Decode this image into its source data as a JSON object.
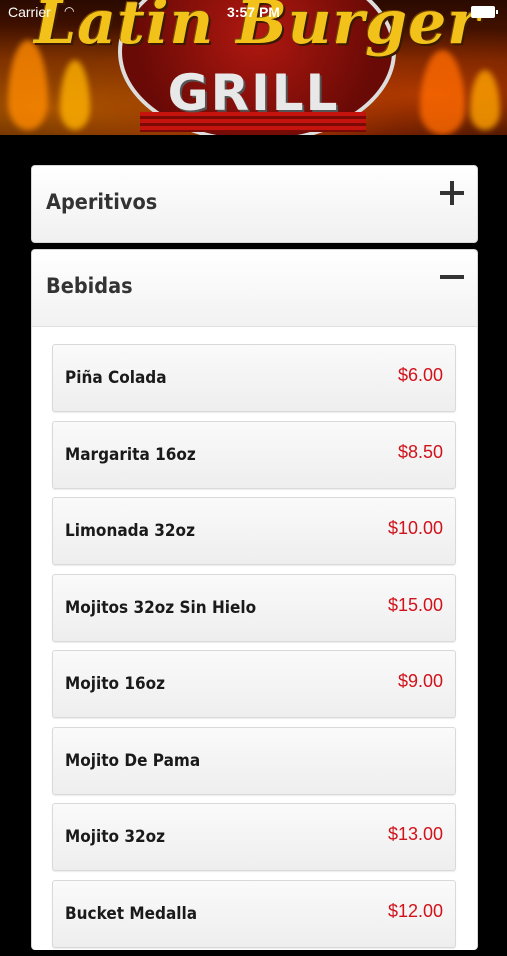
{
  "status_bar": {
    "carrier": "Carrier",
    "time": "3:57 PM",
    "wifi_icon": "wifi-icon",
    "battery_icon": "battery-icon"
  },
  "header": {
    "logo_script": "Latin Burger",
    "logo_sub": "GRILL"
  },
  "sections": [
    {
      "title": "Aperitivos",
      "state": "collapsed",
      "toggle_symbol": "+"
    },
    {
      "title": "Bebidas",
      "state": "expanded",
      "toggle_symbol": "−"
    }
  ],
  "bebidas_items": [
    {
      "name": "Piña Colada",
      "price": "$6.00"
    },
    {
      "name": "Margarita 16oz",
      "price": "$8.50"
    },
    {
      "name": "Limonada 32oz",
      "price": "$10.00"
    },
    {
      "name": "Mojitos 32oz Sin Hielo",
      "price": "$15.00"
    },
    {
      "name": "Mojito 16oz",
      "price": "$9.00"
    },
    {
      "name": "Mojito De Pama",
      "price": ""
    },
    {
      "name": "Mojito 32oz",
      "price": "$13.00"
    },
    {
      "name": "Bucket Medalla",
      "price": "$12.00"
    }
  ],
  "colors": {
    "price": "#d0121b",
    "background": "#000000",
    "panel": "#ffffff"
  }
}
